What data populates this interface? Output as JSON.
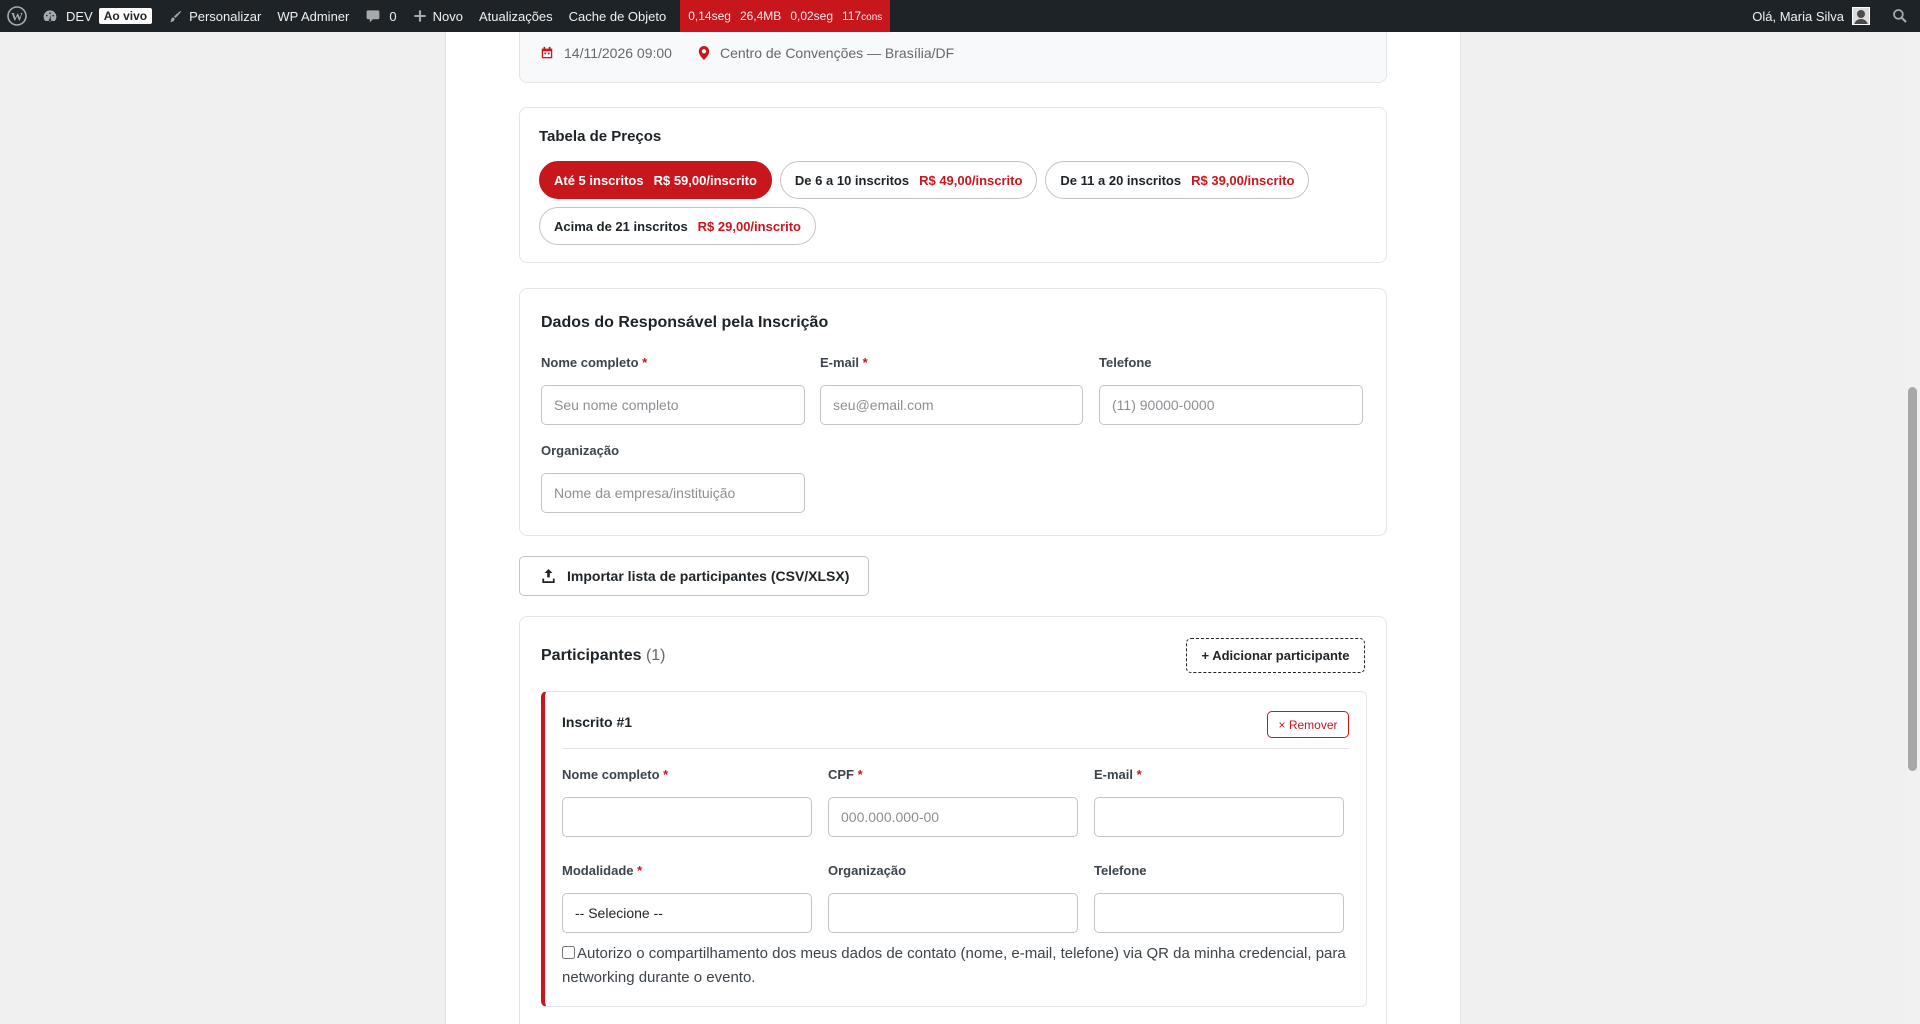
{
  "adminbar": {
    "site_name": "DEV",
    "live_badge": "Ao vivo",
    "customize": "Personalizar",
    "wp_adminer": "WP Adminer",
    "comments_count": "0",
    "new": "Novo",
    "updates": "Atualizações",
    "object_cache": "Cache de Objeto",
    "perf": {
      "time": "0,14seg",
      "memory": "26,4MB",
      "query_time": "0,02seg",
      "queries": "117",
      "queries_unit": "cons"
    },
    "greeting": "Olá, Maria Silva"
  },
  "event": {
    "datetime": "14/11/2026 09:00",
    "location": "Centro de Convenções — Brasília/DF"
  },
  "prices": {
    "title": "Tabela de Preços",
    "tiers": [
      {
        "label": "Até 5 inscritos",
        "price": "R$ 59,00/inscrito",
        "active": true
      },
      {
        "label": "De 6 a 10 inscritos",
        "price": "R$ 49,00/inscrito",
        "active": false
      },
      {
        "label": "De 11 a 20 inscritos",
        "price": "R$ 39,00/inscrito",
        "active": false
      },
      {
        "label": "Acima de 21 inscritos",
        "price": "R$ 29,00/inscrito",
        "active": false
      }
    ]
  },
  "responsible": {
    "title": "Dados do Responsável pela Inscrição",
    "name_label": "Nome completo",
    "name_placeholder": "Seu nome completo",
    "email_label": "E-mail",
    "email_placeholder": "seu@email.com",
    "phone_label": "Telefone",
    "phone_placeholder": "(11) 90000-0000",
    "org_label": "Organização",
    "org_placeholder": "Nome da empresa/instituição",
    "required_mark": "*"
  },
  "import_button": "Importar lista de participantes (CSV/XLSX)",
  "participants": {
    "title": "Participantes",
    "count": "(1)",
    "add_button": "+ Adicionar participante",
    "entry": {
      "title": "Inscrito #1",
      "remove_button": "× Remover",
      "name_label": "Nome completo",
      "cpf_label": "CPF",
      "cpf_placeholder": "000.000.000-00",
      "email_label": "E-mail",
      "modality_label": "Modalidade",
      "modality_value": "-- Selecione --",
      "org_label": "Organização",
      "phone_label": "Telefone",
      "consent_text": "Autorizo o compartilhamento dos meus dados de contato (nome, e-mail, telefone) via QR da minha credencial, para networking durante o evento."
    }
  },
  "colors": {
    "accent": "#c8161d",
    "adminbar": "#1d2327"
  }
}
